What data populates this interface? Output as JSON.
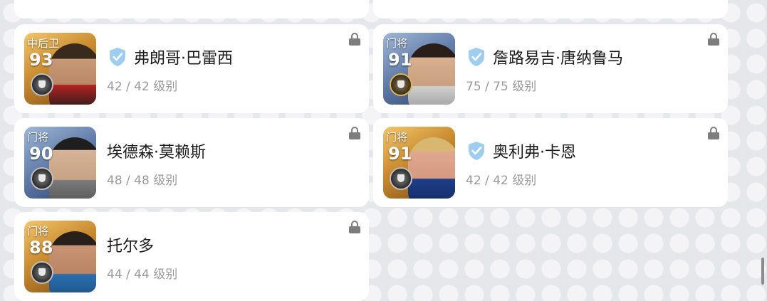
{
  "players": [
    {
      "position": "中后卫",
      "rating": "93",
      "name": "弗朗哥·巴雷西",
      "level": "42 / 42 级别",
      "verified": true,
      "card": "gold",
      "badge": "silver"
    },
    {
      "position": "门将",
      "rating": "91",
      "name": "詹路易吉·唐纳鲁马",
      "level": "75 / 75 级别",
      "verified": true,
      "card": "blue",
      "badge": "gold"
    },
    {
      "position": "门将",
      "rating": "90",
      "name": "埃德森·莫赖斯",
      "level": "48 / 48 级别",
      "verified": false,
      "card": "blue",
      "badge": "silver"
    },
    {
      "position": "门将",
      "rating": "91",
      "name": "奥利弗·卡恩",
      "level": "42 / 42 级别",
      "verified": true,
      "card": "gold",
      "badge": "silver"
    },
    {
      "position": "门将",
      "rating": "88",
      "name": "托尔多",
      "level": "44 / 44 级别",
      "verified": false,
      "card": "gold",
      "badge": "silver"
    }
  ],
  "colors": {
    "shield": "#9fcdf0",
    "lock": "#7d7d7d",
    "level_text": "#9a9a9a"
  }
}
